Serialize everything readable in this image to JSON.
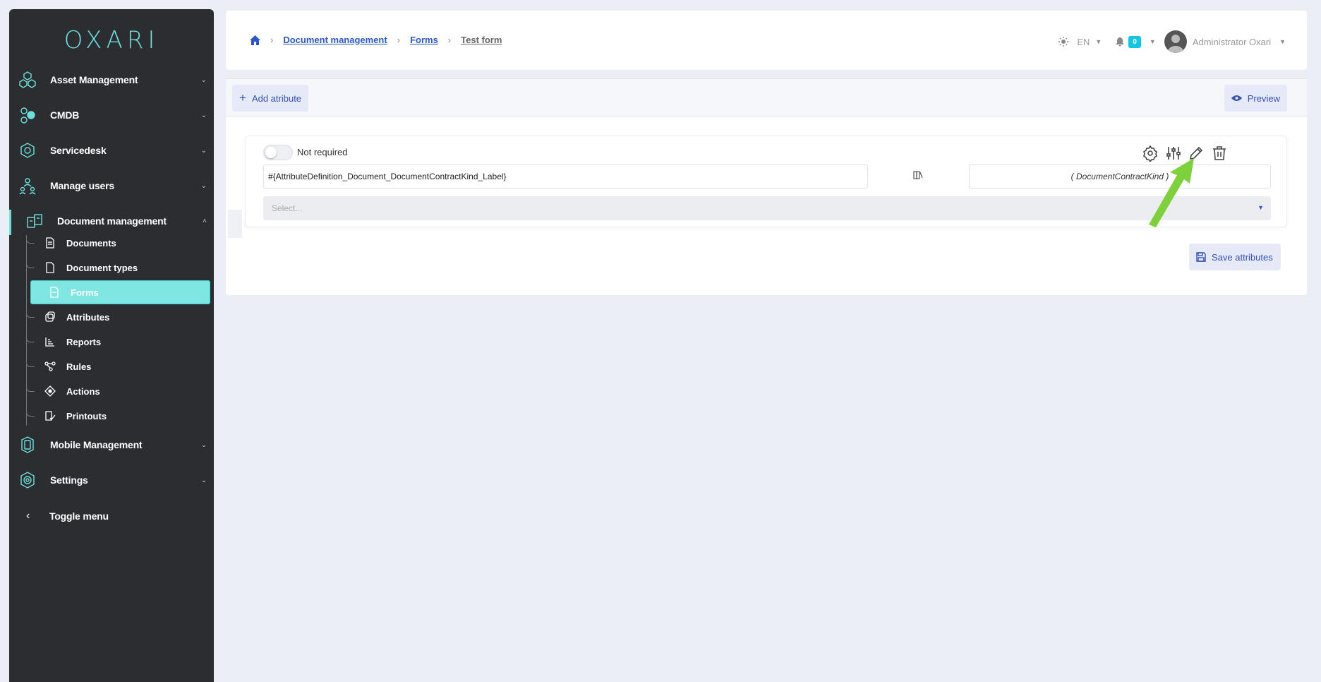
{
  "brand": {
    "logo_text": "OXARI",
    "accent": "#6ee0dc"
  },
  "sidebar": {
    "items": [
      {
        "label": "Asset Management",
        "icon": "hexagons-icon"
      },
      {
        "label": "CMDB",
        "icon": "cubes-icon"
      },
      {
        "label": "Servicedesk",
        "icon": "headset-icon"
      },
      {
        "label": "Manage users",
        "icon": "users-icon"
      },
      {
        "label": "Document management",
        "icon": "documents-icon"
      },
      {
        "label": "Mobile Management",
        "icon": "mobile-icon"
      },
      {
        "label": "Settings",
        "icon": "gear-icon"
      }
    ],
    "sub_items": [
      {
        "label": "Documents",
        "icon": "document-icon"
      },
      {
        "label": "Document types",
        "icon": "file-icon"
      },
      {
        "label": "Forms",
        "icon": "form-icon"
      },
      {
        "label": "Attributes",
        "icon": "attributes-icon"
      },
      {
        "label": "Reports",
        "icon": "reports-icon"
      },
      {
        "label": "Rules",
        "icon": "rules-icon"
      },
      {
        "label": "Actions",
        "icon": "actions-icon"
      },
      {
        "label": "Printouts",
        "icon": "printouts-icon"
      }
    ],
    "toggle_menu": "Toggle menu"
  },
  "breadcrumb": {
    "items": [
      "Document management",
      "Forms"
    ],
    "current": "Test form"
  },
  "header": {
    "language": "EN",
    "notifications_count": "0",
    "user_name": "Administrator Oxari"
  },
  "toolbar": {
    "add_attribute": "Add atribute",
    "preview": "Preview"
  },
  "attribute": {
    "required_label": "Not required",
    "label_value": "#{AttributeDefinition_Document_DocumentContractKind_Label}",
    "kind_value": "( DocumentContractKind )",
    "select_placeholder": "Select..."
  },
  "actions": {
    "save": "Save attributes"
  }
}
